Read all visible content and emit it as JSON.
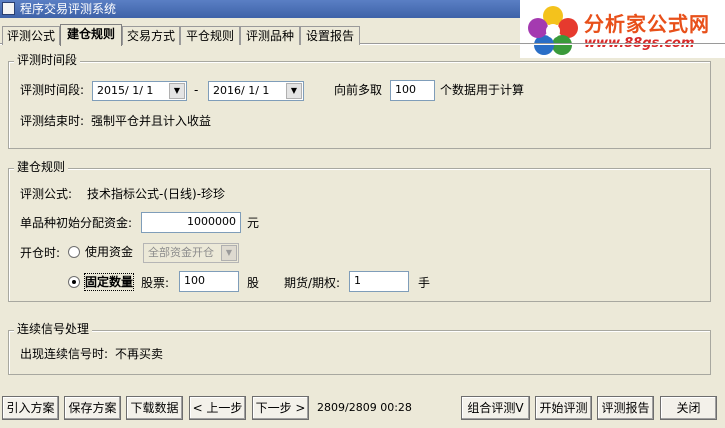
{
  "window": {
    "title": "程序交易评测系统"
  },
  "logo": {
    "brand": "分析家公式网",
    "url": "www.88gs.com"
  },
  "tabs": [
    {
      "label": "评测公式"
    },
    {
      "label": "建仓规则"
    },
    {
      "label": "交易方式"
    },
    {
      "label": "平仓规则"
    },
    {
      "label": "评测品种"
    },
    {
      "label": "设置报告"
    }
  ],
  "period": {
    "group_label": "评测时间段",
    "label": "评测时间段:",
    "start_date": "2015/ 1/ 1",
    "separator": "-",
    "end_date": "2016/ 1/ 1",
    "lookback_prefix": "向前多取",
    "lookback_value": "100",
    "lookback_suffix": "个数据用于计算",
    "end_label": "评测结束时:",
    "end_text": "强制平仓并且计入收益"
  },
  "build": {
    "group_label": "建仓规则",
    "formula_label": "评测公式:",
    "formula_value": "技术指标公式-(日线)-珍珍",
    "capital_label": "单品种初始分配资金:",
    "capital_value": "1000000",
    "capital_unit": "元",
    "open_label": "开仓时:",
    "opt_capital_label": "使用资金",
    "capital_mode_value": "全部资金开仓",
    "opt_fixed_label": "固定数量",
    "stock_label": "股票:",
    "stock_value": "100",
    "stock_unit": "股",
    "futures_label": "期货/期权:",
    "futures_value": "1",
    "futures_unit": "手"
  },
  "signal": {
    "group_label": "连续信号处理",
    "label": "出现连续信号时:",
    "value": "不再买卖"
  },
  "footer": {
    "import": "引入方案",
    "save": "保存方案",
    "download": "下载数据",
    "prev": "< 上一步",
    "next": "下一步 >",
    "status": "2809/2809 00:28",
    "combo": "组合评测V",
    "start": "开始评测",
    "report": "评测报告",
    "close": "关闭"
  },
  "colors": {
    "title_bar": "#3e62a8",
    "logo_text": "#e8501a",
    "logo_url": "#d62a2a"
  }
}
